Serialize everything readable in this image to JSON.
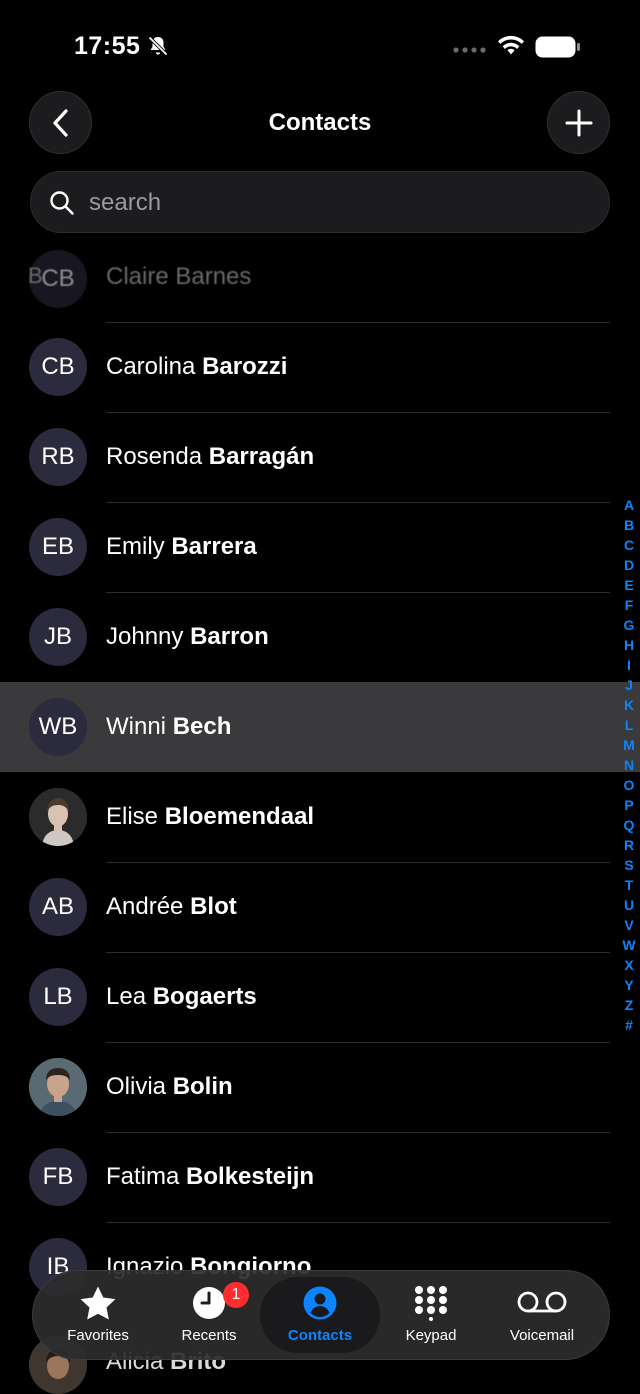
{
  "status_bar": {
    "time": "17:55"
  },
  "nav": {
    "title": "Contacts"
  },
  "search": {
    "placeholder": "search"
  },
  "faded_row": {
    "letter": "B",
    "initials": "CB",
    "name": "Claire Barnes"
  },
  "contacts": [
    {
      "initials": "CB",
      "first": "Carolina",
      "last": "Barozzi"
    },
    {
      "initials": "RB",
      "first": "Rosenda",
      "last": "Barragán"
    },
    {
      "initials": "EB",
      "first": "Emily",
      "last": "Barrera"
    },
    {
      "initials": "JB",
      "first": "Johnny",
      "last": "Barron"
    },
    {
      "initials": "WB",
      "first": "Winni",
      "last": "Bech"
    },
    {
      "initials": "",
      "first": "Elise",
      "last": "Bloemendaal"
    },
    {
      "initials": "AB",
      "first": "Andrée",
      "last": "Blot"
    },
    {
      "initials": "LB",
      "first": "Lea",
      "last": "Bogaerts"
    },
    {
      "initials": "",
      "first": "Olivia",
      "last": "Bolin"
    },
    {
      "initials": "FB",
      "first": "Fatima",
      "last": "Bolkesteijn"
    },
    {
      "initials": "IB",
      "first": "Ignazio",
      "last": "Bongiorno"
    }
  ],
  "bottom_peek": {
    "first": "Alicia",
    "last": "Brito"
  },
  "index_letters": [
    "A",
    "B",
    "C",
    "D",
    "E",
    "F",
    "G",
    "H",
    "I",
    "J",
    "K",
    "L",
    "M",
    "N",
    "O",
    "P",
    "Q",
    "R",
    "S",
    "T",
    "U",
    "V",
    "W",
    "X",
    "Y",
    "Z",
    "#"
  ],
  "tabbar": {
    "favorites": "Favorites",
    "recents": "Recents",
    "recents_badge": "1",
    "contacts": "Contacts",
    "keypad": "Keypad",
    "voicemail": "Voicemail"
  },
  "colors": {
    "accent": "#0a84ff",
    "badge": "#ff2d2d",
    "highlight_row": "#3a3a3c",
    "avatar_bg": "#2c2a3d"
  }
}
